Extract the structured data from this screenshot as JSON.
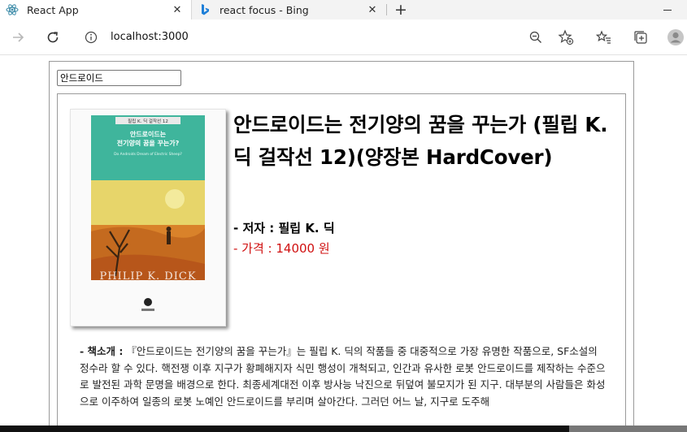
{
  "browser": {
    "tabs": [
      {
        "title": "React App",
        "icon": "react-icon"
      },
      {
        "title": "react focus - Bing",
        "icon": "bing-icon"
      }
    ],
    "address": {
      "url": "localhost:3000"
    }
  },
  "page": {
    "search": {
      "value": "안드로이드"
    },
    "book": {
      "title": "안드로이드는 전기양의 꿈을 꾸는가 (필립 K. 딕 걸작선 12)(양장본 HardCover)",
      "author": "- 저자 : 필립 K. 딕",
      "price": "- 가격 : 14000 원",
      "description_label": "- 책소개 :",
      "description": " 『안드로이드는 전기양의 꿈을 꾸는가』는 필립 K. 딕의 작품들 중 대중적으로 가장 유명한 작품으로, SF소설의 정수라 할 수 있다. 핵전쟁 이후 지구가 황폐해지자 식민 행성이 개척되고, 인간과 유사한 로봇 안드로이드를 제작하는 수준으로 발전된 과학 문명을 배경으로 한다. 최종세계대전 이후 방사능 낙진으로 뒤덮여 불모지가 된 지구. 대부분의 사람들은 화성으로 이주하여 일종의 로봇 노예인 안드로이드를 부리며 살아간다. 그러던 어느 날, 지구로 도주해",
      "cover": {
        "series": "필립 K. 딕 걸작선 12",
        "title_line1": "안드로이드는",
        "title_line2": "전기양의 꿈을 꾸는가?",
        "subtitle": "Do Androids Dream of Electric Sheep?",
        "author": "PHILIP K. DICK",
        "colors": {
          "band": "#3fb59c",
          "sky": "#e7d56a",
          "desert": "#d9822a"
        }
      }
    }
  }
}
